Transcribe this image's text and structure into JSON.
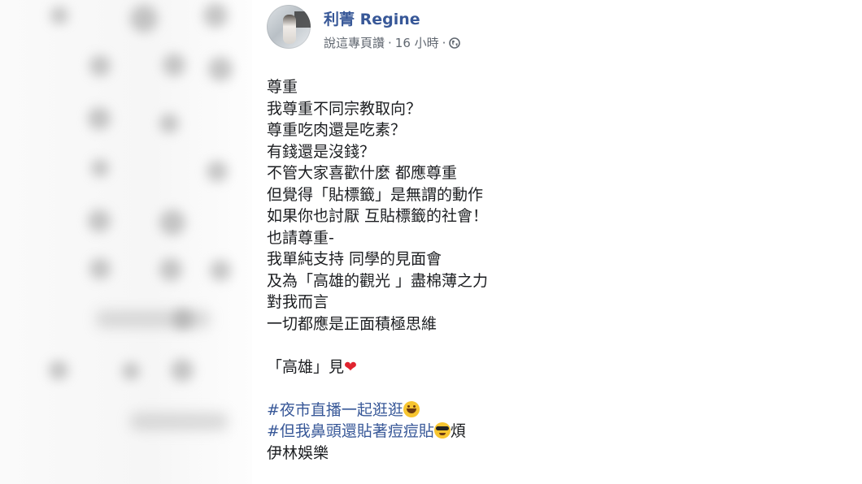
{
  "post": {
    "author_name": "利菁 Regine",
    "meta": {
      "page_action": "說這專頁讚",
      "time": "16 小時",
      "separator": "·"
    },
    "lines": [
      "尊重",
      "我尊重不同宗教取向？",
      "尊重吃肉還是吃素？",
      "有錢還是沒錢？",
      "不管大家喜歡什麼 都應尊重",
      "但覺得「貼標籤」是無謂的動作",
      "如果你也討厭 互貼標籤的社會！",
      "也請尊重-",
      "我單純支持 同學的見面會",
      "及為「高雄的觀光 」盡棉薄之力",
      "對我而言",
      "一切都應是正面積極思維"
    ],
    "closing": {
      "text": "「高雄」見",
      "emoji": "❤"
    },
    "hashtags": [
      {
        "text": "#夜市直播一起逛逛",
        "emoji": "smiling-face",
        "after": ""
      },
      {
        "text": "#但我鼻頭還貼著痘痘貼",
        "emoji": "sunglasses-face",
        "after": "煩"
      }
    ],
    "signature": "伊林娛樂"
  }
}
